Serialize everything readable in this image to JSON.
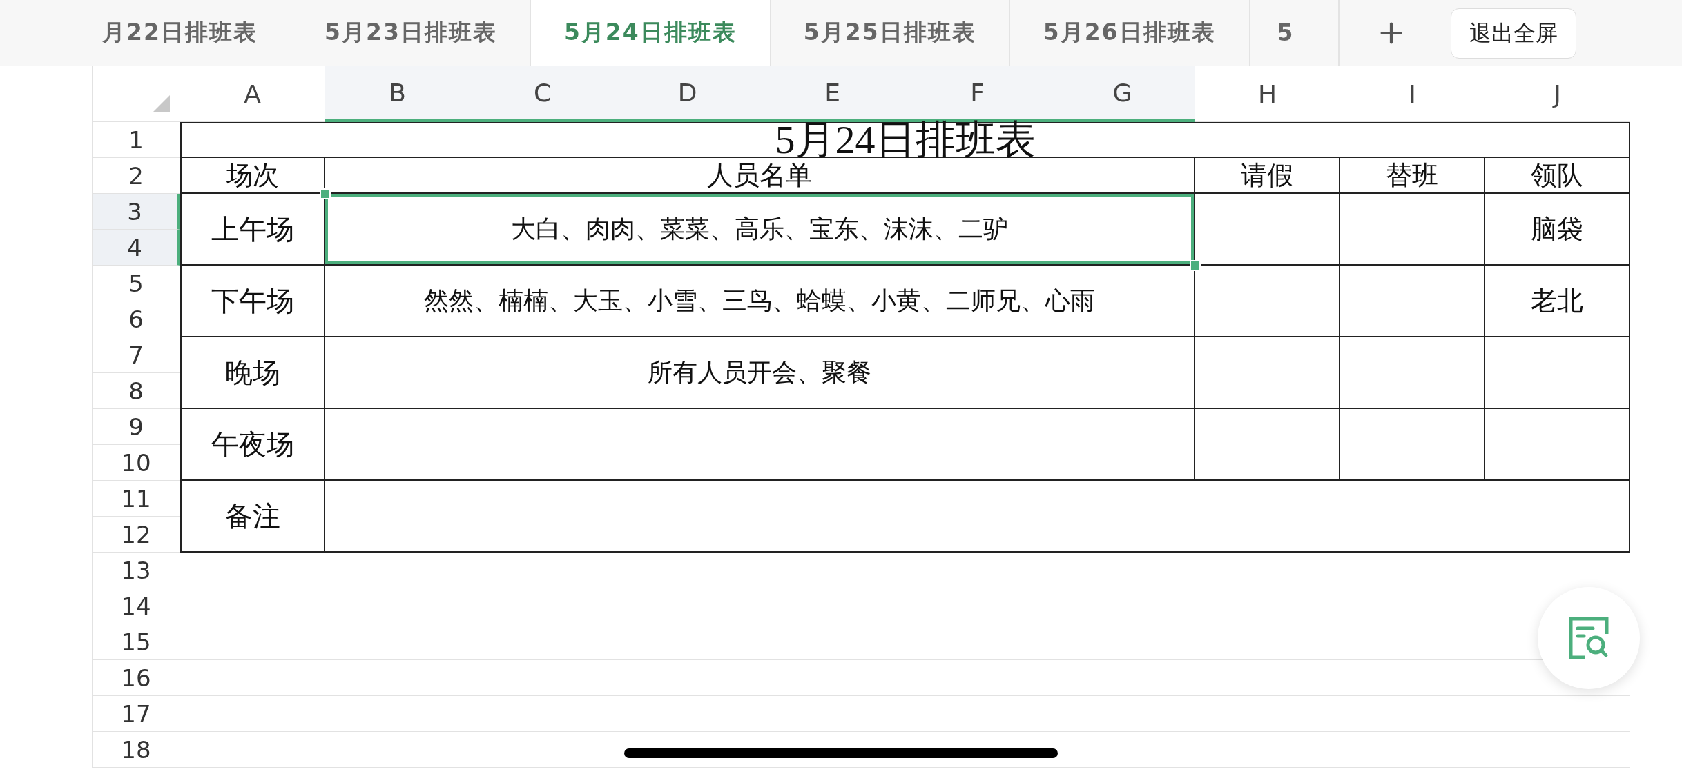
{
  "tabs": [
    {
      "label": "月22日排班表",
      "selected": false
    },
    {
      "label": "5月23日排班表",
      "selected": false
    },
    {
      "label": "5月24日排班表",
      "selected": true
    },
    {
      "label": "5月25日排班表",
      "selected": false
    },
    {
      "label": "5月26日排班表",
      "selected": false
    },
    {
      "label": "5",
      "selected": false
    }
  ],
  "exit_button": {
    "label": "退出全屏"
  },
  "columns": [
    {
      "label": "A",
      "selected": false
    },
    {
      "label": "B",
      "selected": true
    },
    {
      "label": "C",
      "selected": true
    },
    {
      "label": "D",
      "selected": true
    },
    {
      "label": "E",
      "selected": true
    },
    {
      "label": "F",
      "selected": true
    },
    {
      "label": "G",
      "selected": true
    },
    {
      "label": "H",
      "selected": false
    },
    {
      "label": "I",
      "selected": false
    },
    {
      "label": "J",
      "selected": false
    }
  ],
  "rows": [
    {
      "label": "1",
      "selected": false
    },
    {
      "label": "2",
      "selected": false
    },
    {
      "label": "3",
      "selected": true
    },
    {
      "label": "4",
      "selected": true
    },
    {
      "label": "5",
      "selected": false
    },
    {
      "label": "6",
      "selected": false
    },
    {
      "label": "7",
      "selected": false
    },
    {
      "label": "8",
      "selected": false
    },
    {
      "label": "9",
      "selected": false
    },
    {
      "label": "10",
      "selected": false
    },
    {
      "label": "11",
      "selected": false
    },
    {
      "label": "12",
      "selected": false
    },
    {
      "label": "13",
      "selected": false
    },
    {
      "label": "14",
      "selected": false
    },
    {
      "label": "15",
      "selected": false
    },
    {
      "label": "16",
      "selected": false
    },
    {
      "label": "17",
      "selected": false
    },
    {
      "label": "18",
      "selected": false
    }
  ],
  "table": {
    "title": "5月24日排班表",
    "header": [
      "场次",
      "人员名单",
      "请假",
      "替班",
      "领队"
    ],
    "sessions": [
      {
        "name": "上午场",
        "staff": "大白、肉肉、菜菜、高乐、宝东、沫沫、二驴",
        "leader": "脑袋",
        "selected": true
      },
      {
        "name": "下午场",
        "staff": "然然、楠楠、大玉、小雪、三鸟、蛤蟆、小黄、二师兄、心雨",
        "leader": "老北",
        "selected": false
      },
      {
        "name": "晚场",
        "staff": "所有人员开会、聚餐",
        "selected": false
      },
      {
        "name": "午夜场",
        "selected": false
      }
    ],
    "note": {
      "label": "备注"
    }
  }
}
